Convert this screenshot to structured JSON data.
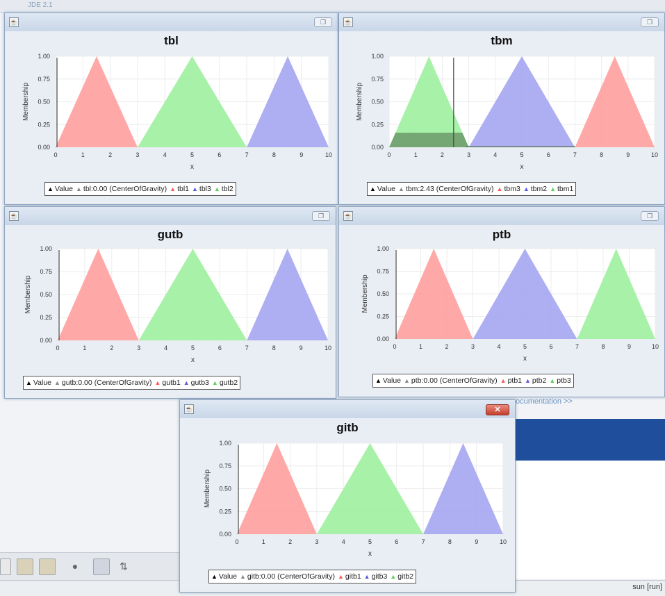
{
  "background": {
    "topbar_text": "JDE 2.1",
    "link_text": "ocumentation >>",
    "status_text": "sun [run]"
  },
  "colors": {
    "red": "#ff9f9f",
    "green": "#9ff09f",
    "blue": "#a5a5f2",
    "dark": "#4a6a4a"
  },
  "icons": {
    "window_icon": "app-window-icon",
    "maximize": "maximize-icon",
    "close": "close-icon"
  },
  "windows": [
    {
      "id": "tbl",
      "title": "tbl",
      "xlabel": "x",
      "ylabel": "Membership",
      "yticks": [
        "1.00",
        "0.75",
        "0.50",
        "0.25",
        "0.00"
      ],
      "xticks": [
        "0",
        "1",
        "2",
        "3",
        "4",
        "5",
        "6",
        "7",
        "8",
        "9",
        "10"
      ],
      "value_line": 0.0,
      "value_text": "tbl:0.00 (CenterOfGravity)",
      "triangles": [
        {
          "name": "tbl1",
          "color": "red",
          "a": 0,
          "b": 1.5,
          "c": 3
        },
        {
          "name": "tbl3",
          "color": "blue",
          "a": 7,
          "b": 8.5,
          "c": 10
        },
        {
          "name": "tbl2",
          "color": "green",
          "a": 3,
          "b": 5,
          "c": 7
        }
      ]
    },
    {
      "id": "tbm",
      "title": "tbm",
      "xlabel": "x",
      "ylabel": "Membership",
      "yticks": [
        "1.00",
        "0.75",
        "0.50",
        "0.25",
        "0.00"
      ],
      "xticks": [
        "0",
        "1",
        "2",
        "3",
        "4",
        "5",
        "6",
        "7",
        "8",
        "9",
        "10"
      ],
      "value_line": 2.43,
      "value_text": "tbm:2.43 (CenterOfGravity)",
      "triangles": [
        {
          "name": "tbm3",
          "color": "red",
          "a": 7,
          "b": 8.5,
          "c": 10
        },
        {
          "name": "tbm2",
          "color": "blue",
          "a": 3,
          "b": 5,
          "c": 7
        },
        {
          "name": "tbm1",
          "color": "green",
          "a": 0,
          "b": 1.5,
          "c": 3
        }
      ],
      "aggregate": {
        "height": 0.16,
        "a": 0,
        "c": 3
      }
    },
    {
      "id": "gutb",
      "title": "gutb",
      "xlabel": "x",
      "ylabel": "Membership",
      "yticks": [
        "1.00",
        "0.75",
        "0.50",
        "0.25",
        "0.00"
      ],
      "xticks": [
        "0",
        "1",
        "2",
        "3",
        "4",
        "5",
        "6",
        "7",
        "8",
        "9",
        "10"
      ],
      "value_line": 0.0,
      "value_text": "gutb:0.00 (CenterOfGravity)",
      "triangles": [
        {
          "name": "gutb1",
          "color": "red",
          "a": 0,
          "b": 1.5,
          "c": 3
        },
        {
          "name": "gutb3",
          "color": "blue",
          "a": 7,
          "b": 8.5,
          "c": 10
        },
        {
          "name": "gutb2",
          "color": "green",
          "a": 3,
          "b": 5,
          "c": 7
        }
      ]
    },
    {
      "id": "ptb",
      "title": "ptb",
      "xlabel": "x",
      "ylabel": "Membership",
      "yticks": [
        "1.00",
        "0.75",
        "0.50",
        "0.25",
        "0.00"
      ],
      "xticks": [
        "0",
        "1",
        "2",
        "3",
        "4",
        "5",
        "6",
        "7",
        "8",
        "9",
        "10"
      ],
      "value_line": 0.0,
      "value_text": "ptb:0.00 (CenterOfGravity)",
      "triangles": [
        {
          "name": "ptb1",
          "color": "red",
          "a": 0,
          "b": 1.5,
          "c": 3
        },
        {
          "name": "ptb2",
          "color": "blue",
          "a": 3,
          "b": 5,
          "c": 7
        },
        {
          "name": "ptb3",
          "color": "green",
          "a": 7,
          "b": 8.5,
          "c": 10
        }
      ]
    },
    {
      "id": "gitb",
      "title": "gitb",
      "xlabel": "x",
      "ylabel": "Membership",
      "yticks": [
        "1.00",
        "0.75",
        "0.50",
        "0.25",
        "0.00"
      ],
      "xticks": [
        "0",
        "1",
        "2",
        "3",
        "4",
        "5",
        "6",
        "7",
        "8",
        "9",
        "10"
      ],
      "value_line": 0.0,
      "value_text": "gitb:0.00 (CenterOfGravity)",
      "triangles": [
        {
          "name": "gitb1",
          "color": "red",
          "a": 0,
          "b": 1.5,
          "c": 3
        },
        {
          "name": "gitb3",
          "color": "blue",
          "a": 7,
          "b": 8.5,
          "c": 10
        },
        {
          "name": "gitb2",
          "color": "green",
          "a": 3,
          "b": 5,
          "c": 7
        }
      ]
    }
  ],
  "legend_labels": {
    "value": "Value"
  },
  "chart_data": [
    {
      "type": "area",
      "title": "tbl",
      "xlabel": "x",
      "ylabel": "Membership",
      "xlim": [
        0,
        10
      ],
      "ylim": [
        0,
        1
      ],
      "series": [
        {
          "name": "tbl1",
          "x": [
            0,
            1.5,
            3
          ],
          "values": [
            0,
            1,
            0
          ]
        },
        {
          "name": "tbl3",
          "x": [
            7,
            8.5,
            10
          ],
          "values": [
            0,
            1,
            0
          ]
        },
        {
          "name": "tbl2",
          "x": [
            3,
            5,
            7
          ],
          "values": [
            0,
            1,
            0
          ]
        }
      ]
    },
    {
      "type": "area",
      "title": "tbm",
      "xlabel": "x",
      "ylabel": "Membership",
      "xlim": [
        0,
        10
      ],
      "ylim": [
        0,
        1
      ],
      "series": [
        {
          "name": "tbm3",
          "x": [
            7,
            8.5,
            10
          ],
          "values": [
            0,
            1,
            0
          ]
        },
        {
          "name": "tbm2",
          "x": [
            3,
            5,
            7
          ],
          "values": [
            0,
            1,
            0
          ]
        },
        {
          "name": "tbm1",
          "x": [
            0,
            1.5,
            3
          ],
          "values": [
            0,
            1,
            0
          ]
        }
      ]
    },
    {
      "type": "area",
      "title": "gutb",
      "xlabel": "x",
      "ylabel": "Membership",
      "xlim": [
        0,
        10
      ],
      "ylim": [
        0,
        1
      ],
      "series": [
        {
          "name": "gutb1",
          "x": [
            0,
            1.5,
            3
          ],
          "values": [
            0,
            1,
            0
          ]
        },
        {
          "name": "gutb3",
          "x": [
            7,
            8.5,
            10
          ],
          "values": [
            0,
            1,
            0
          ]
        },
        {
          "name": "gutb2",
          "x": [
            3,
            5,
            7
          ],
          "values": [
            0,
            1,
            0
          ]
        }
      ]
    },
    {
      "type": "area",
      "title": "ptb",
      "xlabel": "x",
      "ylabel": "Membership",
      "xlim": [
        0,
        10
      ],
      "ylim": [
        0,
        1
      ],
      "series": [
        {
          "name": "ptb1",
          "x": [
            0,
            1.5,
            3
          ],
          "values": [
            0,
            1,
            0
          ]
        },
        {
          "name": "ptb2",
          "x": [
            3,
            5,
            7
          ],
          "values": [
            0,
            1,
            0
          ]
        },
        {
          "name": "ptb3",
          "x": [
            7,
            8.5,
            10
          ],
          "values": [
            0,
            1,
            0
          ]
        }
      ]
    },
    {
      "type": "area",
      "title": "gitb",
      "xlabel": "x",
      "ylabel": "Membership",
      "xlim": [
        0,
        10
      ],
      "ylim": [
        0,
        1
      ],
      "series": [
        {
          "name": "gitb1",
          "x": [
            0,
            1.5,
            3
          ],
          "values": [
            0,
            1,
            0
          ]
        },
        {
          "name": "gitb3",
          "x": [
            7,
            8.5,
            10
          ],
          "values": [
            0,
            1,
            0
          ]
        },
        {
          "name": "gitb2",
          "x": [
            3,
            5,
            7
          ],
          "values": [
            0,
            1,
            0
          ]
        }
      ]
    }
  ]
}
